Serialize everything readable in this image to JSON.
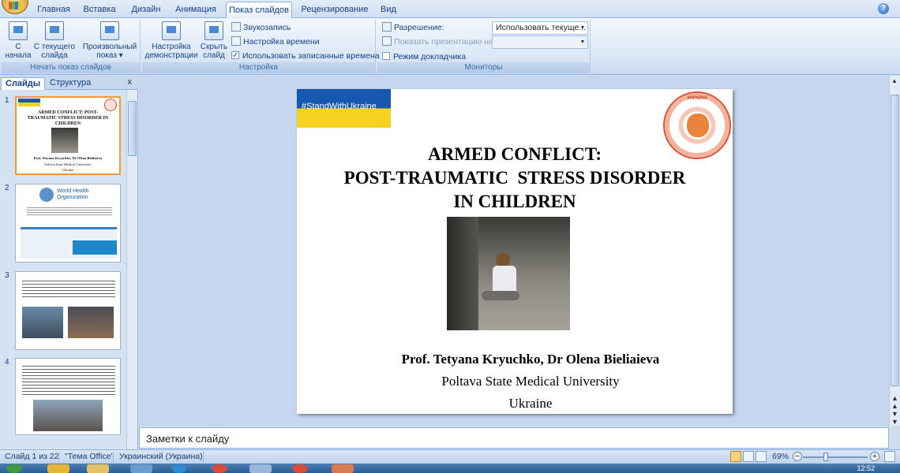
{
  "ribbon_tabs": [
    "Главная",
    "Вставка",
    "Дизайн",
    "Анимация",
    "Показ слайдов",
    "Рецензирование",
    "Вид"
  ],
  "active_tab": "Показ слайдов",
  "groups": {
    "start": {
      "label": "Начать показ слайдов",
      "btn1": [
        "С",
        "начала"
      ],
      "btn2": [
        "С текущего",
        "слайда"
      ],
      "btn3": [
        "Произвольный",
        "показ ▾"
      ]
    },
    "setup": {
      "label": "Настройка",
      "btn1": [
        "Настройка",
        "демонстрации"
      ],
      "btn2": [
        "Скрыть",
        "слайд"
      ],
      "record": "Звукозапись",
      "timing": "Настройка времени",
      "use_timings": "Использовать записанные времена"
    },
    "monitors": {
      "label": "Мониторы",
      "resolution": "Разрешение:",
      "resolution_value": "Использовать текуще...",
      "show_on": "Показать презентацию на:",
      "presenter": "Режим докладчика"
    }
  },
  "pane": {
    "tab_slides": "Слайды",
    "tab_outline": "Структура",
    "close": "x"
  },
  "thumbnails": {
    "t1": {
      "num": "1",
      "title": "ARMED CONFLICT: POST-TRAUMATIC STRESS DISORDER IN CHILDREN",
      "authors": "Prof. Tetyana Kryuchko, Dr Olena Bieliaieva",
      "univ": "Poltava State Medical University",
      "country": "Ukraine"
    },
    "t2": {
      "num": "2",
      "org1": "World Health",
      "org2": "Organization"
    },
    "t3": {
      "num": "3"
    },
    "t4": {
      "num": "4"
    }
  },
  "slide": {
    "banner": "#StandWithUkraine",
    "seal_text": "УКРАЇНА",
    "title_line1": "ARMED CONFLICT:",
    "title_line2": "POST-TRAUMATIC  STRESS DISORDER",
    "title_line3": "IN CHILDREN",
    "authors": "Prof. Tetyana Kryuchko, Dr Olena Bieliaieva",
    "university": "Poltava State Medical University",
    "country": "Ukraine"
  },
  "notes_placeholder": "Заметки к слайду",
  "status": {
    "slide_of": "Слайд 1 из 22",
    "theme": "\"Тема Office\"",
    "language": "Украинский (Украина)",
    "zoom": "69%"
  },
  "clock": "12:52",
  "colors": {
    "accent_tab": "#8db2e3",
    "selected_thumb": "#f39a35",
    "banner_blue": "#1558b0",
    "banner_yellow": "#f4d21f"
  }
}
